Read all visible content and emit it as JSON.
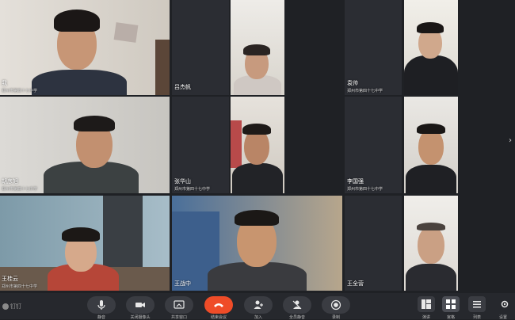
{
  "participants": [
    {
      "name": "我",
      "org": "郑州市第四十七中学"
    },
    {
      "name": "吕杰帆",
      "org": ""
    },
    {
      "name": "",
      "org": ""
    },
    {
      "name": "袁帅",
      "org": "郑州市第四十七中学"
    },
    {
      "name": "",
      "org": ""
    },
    {
      "name": "胡彦旭",
      "org": "郑州市第四十七中学"
    },
    {
      "name": "张华山",
      "org": "郑州市第四十七中学"
    },
    {
      "name": "",
      "org": ""
    },
    {
      "name": "李国强",
      "org": "郑州市第四十七中学"
    },
    {
      "name": "",
      "org": ""
    },
    {
      "name": "王桂云",
      "org": "郑州市第四十七中学"
    },
    {
      "name": "王战中",
      "org": ""
    },
    {
      "name": "王全营",
      "org": ""
    },
    {
      "name": "",
      "org": ""
    }
  ],
  "app": {
    "logo_text": "钉钉"
  },
  "toolbar": {
    "mute": "静音",
    "camera_off": "关闭摄像头",
    "share_screen": "共享窗口",
    "end_meeting": "结束会议",
    "add_person": "加入",
    "all_mute": "全员静音",
    "record": "录制",
    "layout_speaker": "演讲",
    "layout_grid": "宫格",
    "list": "列表",
    "settings": "设置"
  },
  "colors": {
    "end_button": "#ef4c28",
    "background": "#1f2125"
  }
}
